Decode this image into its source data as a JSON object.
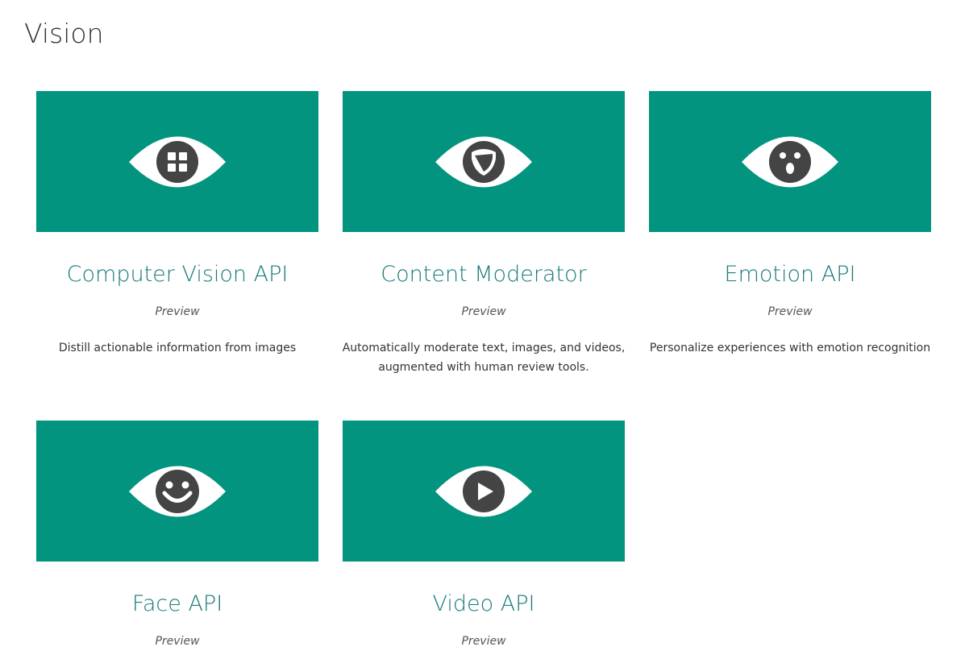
{
  "page": {
    "title": "Vision"
  },
  "colors": {
    "tile": "#03947f",
    "title_link": "#197a7a",
    "eye_white": "#ffffff",
    "pupil": "#444444"
  },
  "cards": [
    {
      "name": "Computer Vision API",
      "status": "Preview",
      "description": "Distill actionable information from images",
      "icon": "eye-grid-icon"
    },
    {
      "name": "Content Moderator",
      "status": "Preview",
      "description": "Automatically moderate text, images, and videos, augmented with human review tools.",
      "icon": "eye-shield-icon"
    },
    {
      "name": "Emotion API",
      "status": "Preview",
      "description": "Personalize experiences with emotion recognition",
      "icon": "eye-surprised-face-icon"
    },
    {
      "name": "Face API",
      "status": "Preview",
      "description": "",
      "icon": "eye-smiley-face-icon"
    },
    {
      "name": "Video API",
      "status": "Preview",
      "description": "",
      "icon": "eye-play-icon"
    }
  ]
}
